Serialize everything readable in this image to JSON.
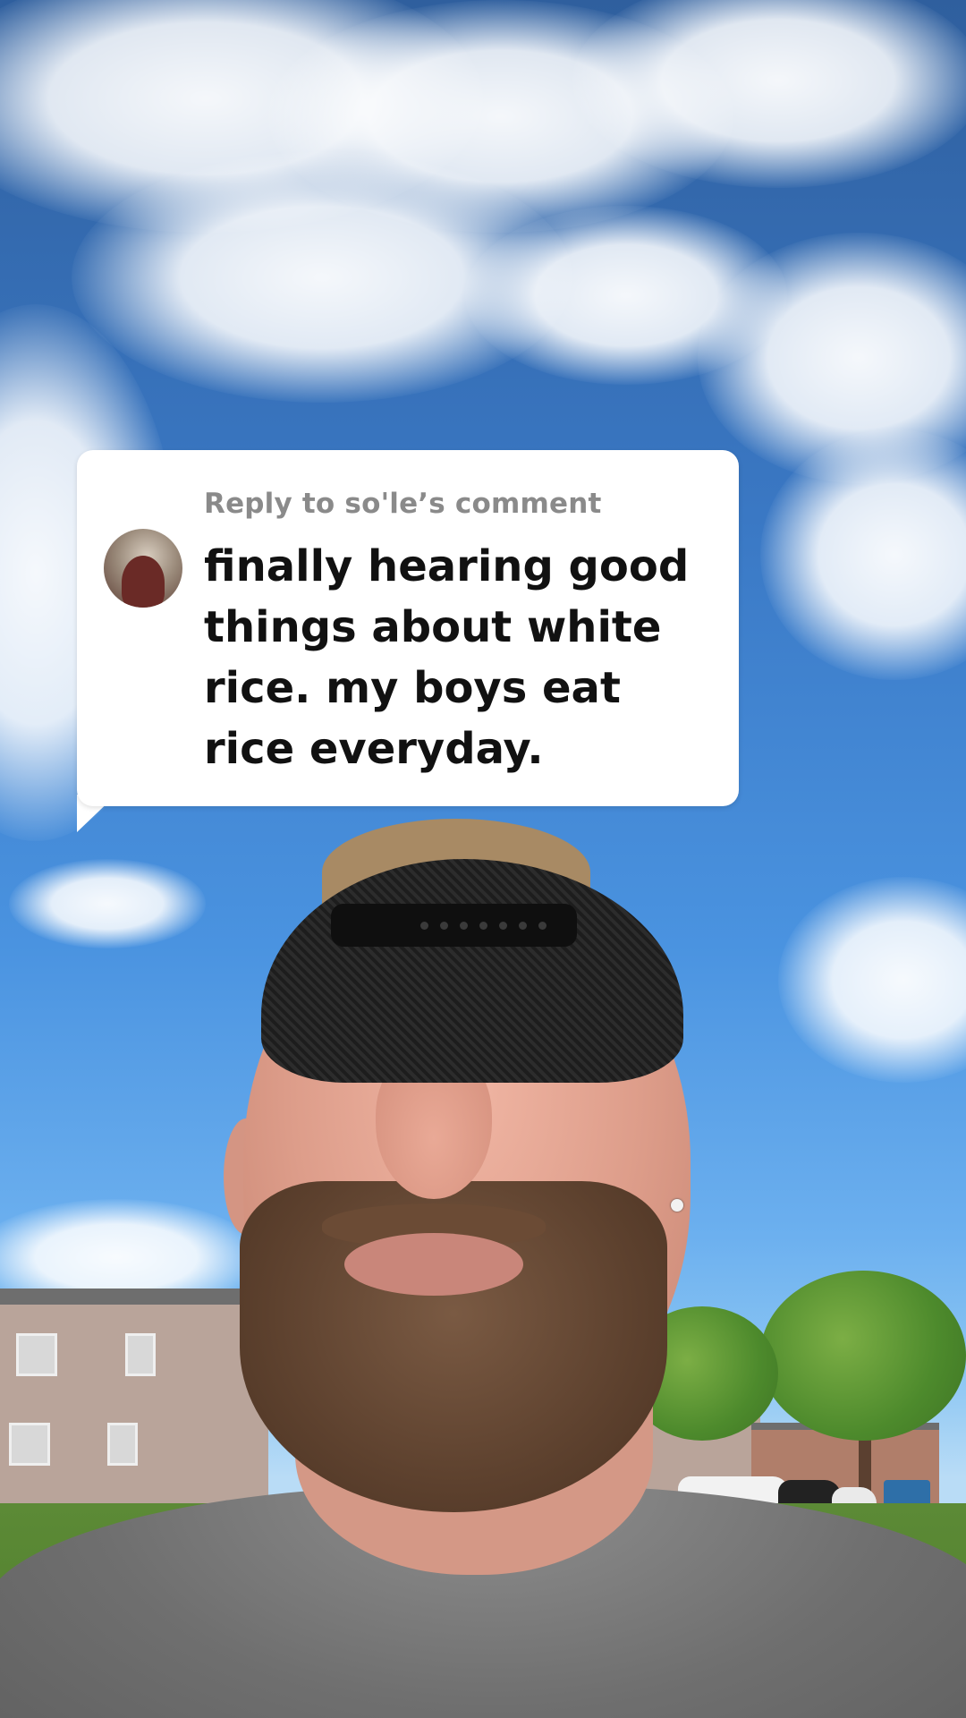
{
  "comment_bubble": {
    "reply_header": "Reply to so'le’s comment",
    "comment_text": "finally hearing good things about white rice. my boys eat rice everyday.",
    "avatar_icon": "user-avatar"
  },
  "colors": {
    "bubble_background": "#ffffff",
    "header_text": "#8a8a8a",
    "comment_text": "#111111",
    "sky": "#4a93e0"
  }
}
